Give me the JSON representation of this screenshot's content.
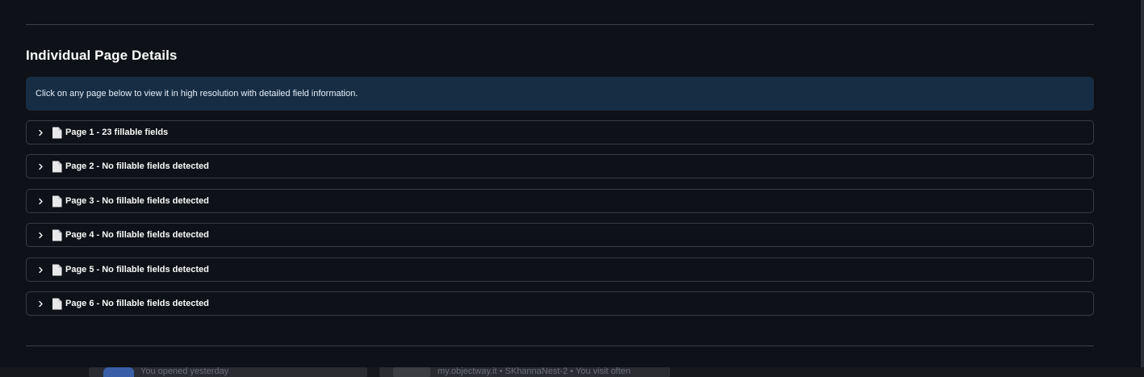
{
  "section": {
    "title": "Individual Page Details"
  },
  "info": {
    "text": "Click on any page below to view it in high resolution with detailed field information."
  },
  "pages": [
    {
      "label": "Page 1 - 23 fillable fields"
    },
    {
      "label": "Page 2 - No fillable fields detected"
    },
    {
      "label": "Page 3 - No fillable fields detected"
    },
    {
      "label": "Page 4 - No fillable fields detected"
    },
    {
      "label": "Page 5 - No fillable fields detected"
    },
    {
      "label": "Page 6 - No fillable fields detected"
    }
  ],
  "background_hints": {
    "left_text": "You opened yesterday",
    "right_text": "my.objectway.it • SKhannaNest-2 • You visit often"
  },
  "colors": {
    "background": "#0e1117",
    "info_box": "#172d43",
    "border": "#3a3d46",
    "text": "#fafafa"
  },
  "icons": {
    "expander_toggle": "chevron-right-icon",
    "page": "document-icon"
  }
}
